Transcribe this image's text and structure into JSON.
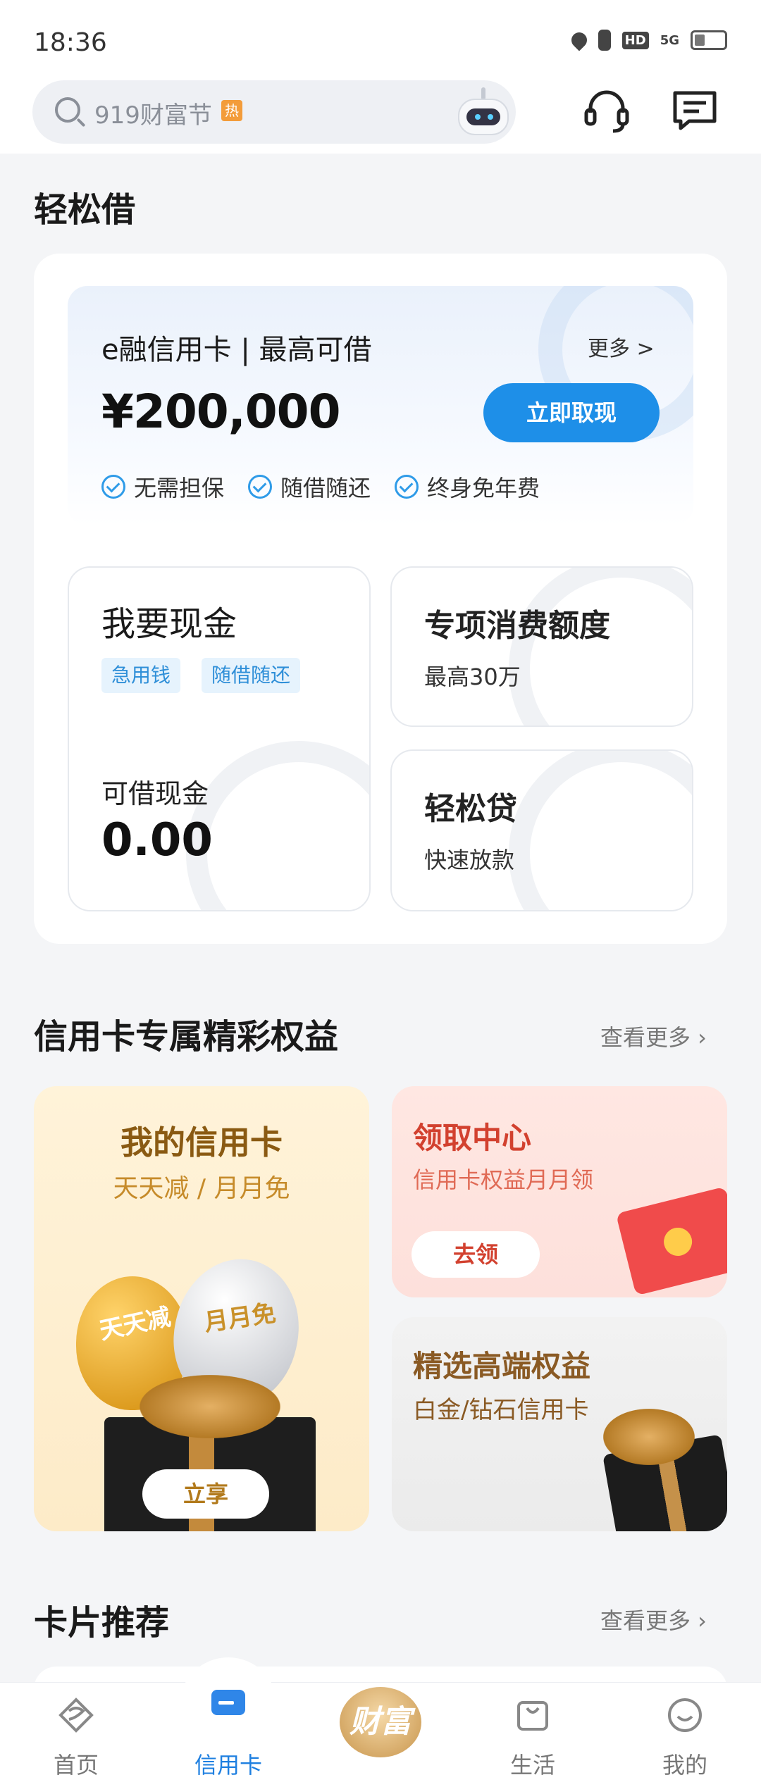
{
  "status_bar": {
    "time": "18:36",
    "network": "5G",
    "hd": "HD"
  },
  "search": {
    "placeholder": "919财富节",
    "hot_badge": "热"
  },
  "sections": {
    "easy_borrow_title": "轻松借",
    "benefits_title": "信用卡专属精彩权益",
    "benefits_more": "查看更多 ›",
    "cards_title": "卡片推荐",
    "cards_more": "查看更多 ›"
  },
  "credit_panel": {
    "title": "e融信用卡 | 最高可借",
    "more": "更多 >",
    "amount": "¥200,000",
    "button": "立即取现",
    "features": [
      "无需担保",
      "随借随还",
      "终身免年费"
    ]
  },
  "cash_tile": {
    "title": "我要现金",
    "tags": [
      "急用钱",
      "随借随还"
    ],
    "label": "可借现金",
    "value": "0.00"
  },
  "special_tile": {
    "title": "专项消费额度",
    "sub": "最高30万"
  },
  "loan_tile": {
    "title": "轻松贷",
    "sub": "快速放款"
  },
  "benefit_mine": {
    "title": "我的信用卡",
    "sub": "天天减 / 月月免",
    "balloon_gold": "天天减",
    "balloon_silver": "月月免",
    "button": "立享"
  },
  "benefit_center": {
    "title": "领取中心",
    "sub": "信用卡权益月月领",
    "button": "去领"
  },
  "benefit_premium": {
    "title": "精选高端权益",
    "sub": "白金/钻石信用卡"
  },
  "bottom_nav": {
    "items": [
      {
        "label": "首页",
        "icon": "home-icon"
      },
      {
        "label": "信用卡",
        "icon": "credit-card-icon"
      },
      {
        "label": "财富",
        "icon": "fortune-icon"
      },
      {
        "label": "生活",
        "icon": "shopping-bag-icon"
      },
      {
        "label": "我的",
        "icon": "profile-icon"
      }
    ],
    "active": "信用卡"
  },
  "colors": {
    "accent": "#1e8fe8",
    "benefit_red": "#d2412f",
    "benefit_gold": "#8a5a12"
  }
}
